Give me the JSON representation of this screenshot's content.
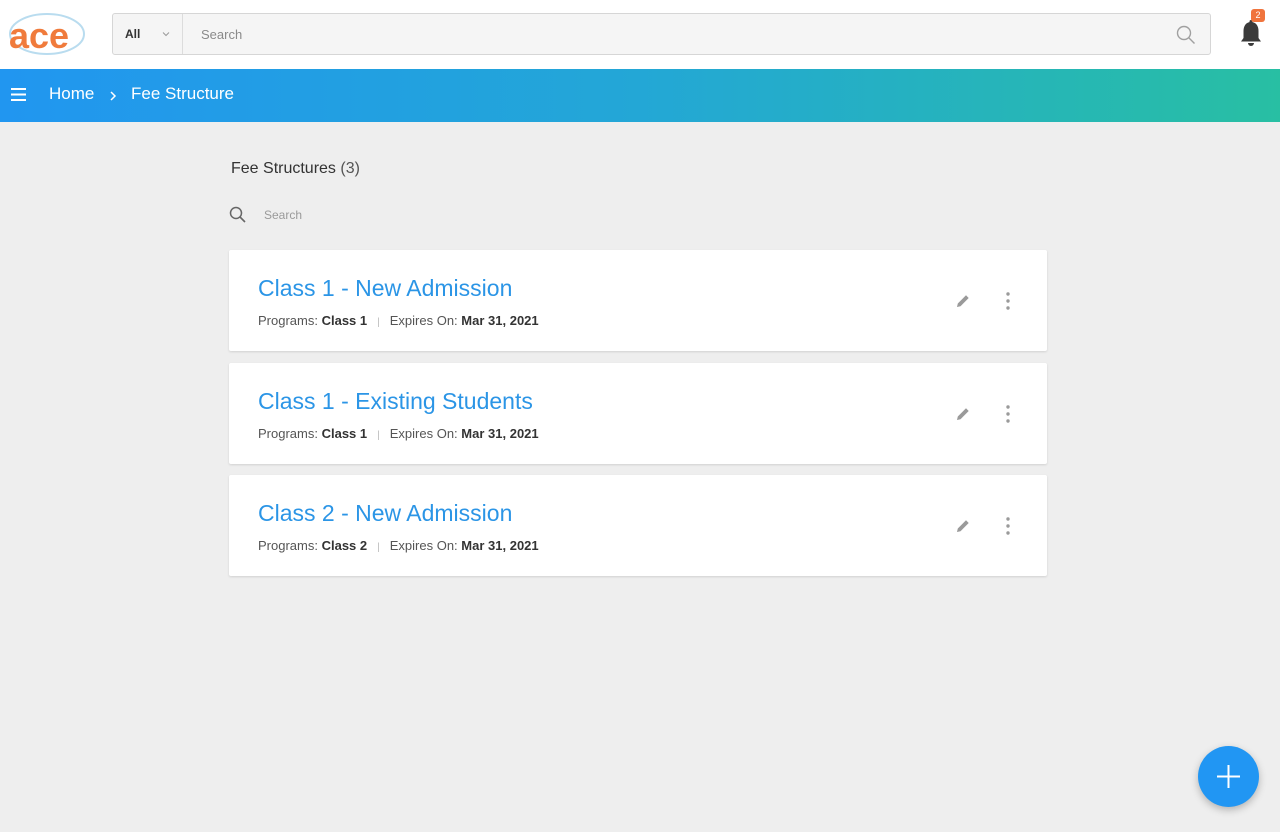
{
  "topbar": {
    "logo_text": "ace",
    "scope_label": "All",
    "search_placeholder": "Search",
    "notification_count": "2"
  },
  "breadcrumb": {
    "home": "Home",
    "current": "Fee Structure"
  },
  "list": {
    "title": "Fee Structures",
    "count": "(3)",
    "search_placeholder": "Search",
    "programs_label": "Programs:",
    "expires_label": "Expires On:",
    "items": [
      {
        "name": "Class 1 - New Admission",
        "program": "Class 1",
        "expires": "Mar 31, 2021"
      },
      {
        "name": "Class 1 - Existing Students",
        "program": "Class 1",
        "expires": "Mar 31, 2021"
      },
      {
        "name": "Class 2 - New Admission",
        "program": "Class 2",
        "expires": "Mar 31, 2021"
      }
    ]
  },
  "colors": {
    "accent": "#2196f3",
    "link": "#2b95e6",
    "badge": "#f0743d"
  },
  "icons": {
    "search": "search-icon",
    "bell": "bell-icon",
    "menu": "menu-icon",
    "edit": "pencil-icon",
    "more": "more-vertical-icon",
    "add": "plus-icon"
  }
}
